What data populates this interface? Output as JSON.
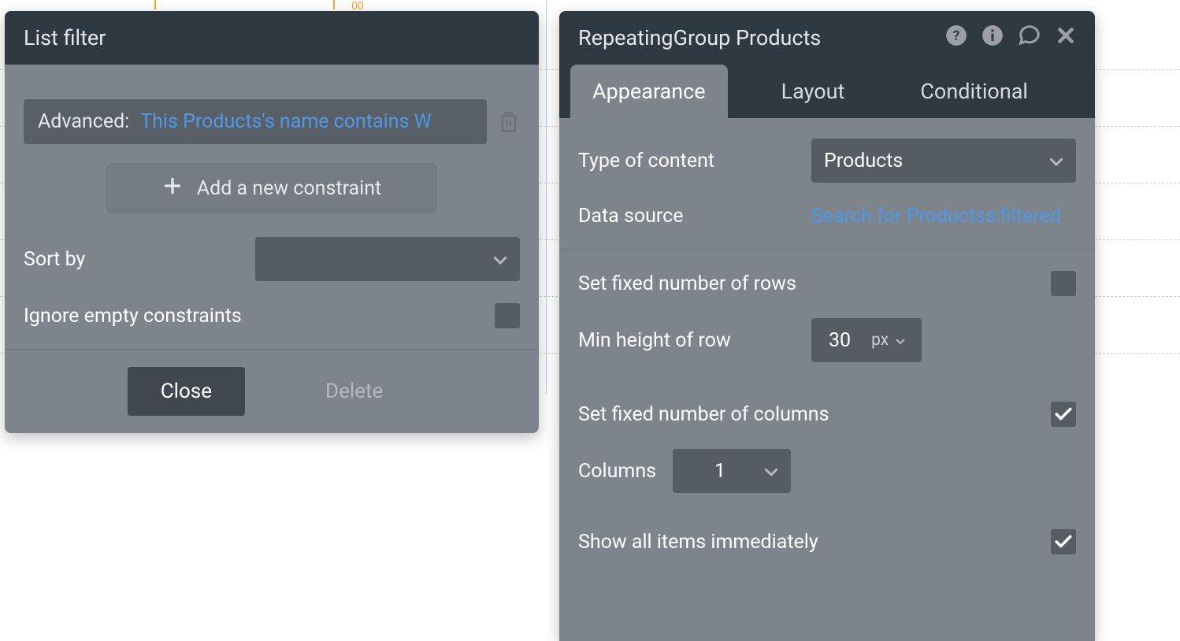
{
  "canvas": {
    "tick_label": "00"
  },
  "list_filter": {
    "title": "List filter",
    "advanced_label": "Advanced:",
    "advanced_expression": "This Products's name contains W",
    "add_constraint_label": "Add a new constraint",
    "sort_by_label": "Sort by",
    "sort_by_value": "",
    "ignore_empty_label": "Ignore empty constraints",
    "ignore_empty_checked": false,
    "close_label": "Close",
    "delete_label": "Delete"
  },
  "properties": {
    "title": "RepeatingGroup Products",
    "tabs": {
      "appearance": "Appearance",
      "layout": "Layout",
      "conditional": "Conditional",
      "active": "appearance"
    },
    "type_of_content_label": "Type of content",
    "type_of_content_value": "Products",
    "data_source_label": "Data source",
    "data_source_value": "Search for Productss:filtered",
    "set_fixed_rows_label": "Set fixed number of rows",
    "set_fixed_rows_checked": false,
    "min_height_label": "Min height of row",
    "min_height_value": "30",
    "min_height_unit": "px",
    "set_fixed_cols_label": "Set fixed number of columns",
    "set_fixed_cols_checked": true,
    "columns_label": "Columns",
    "columns_value": "1",
    "show_all_label": "Show all items immediately",
    "show_all_checked": true
  }
}
